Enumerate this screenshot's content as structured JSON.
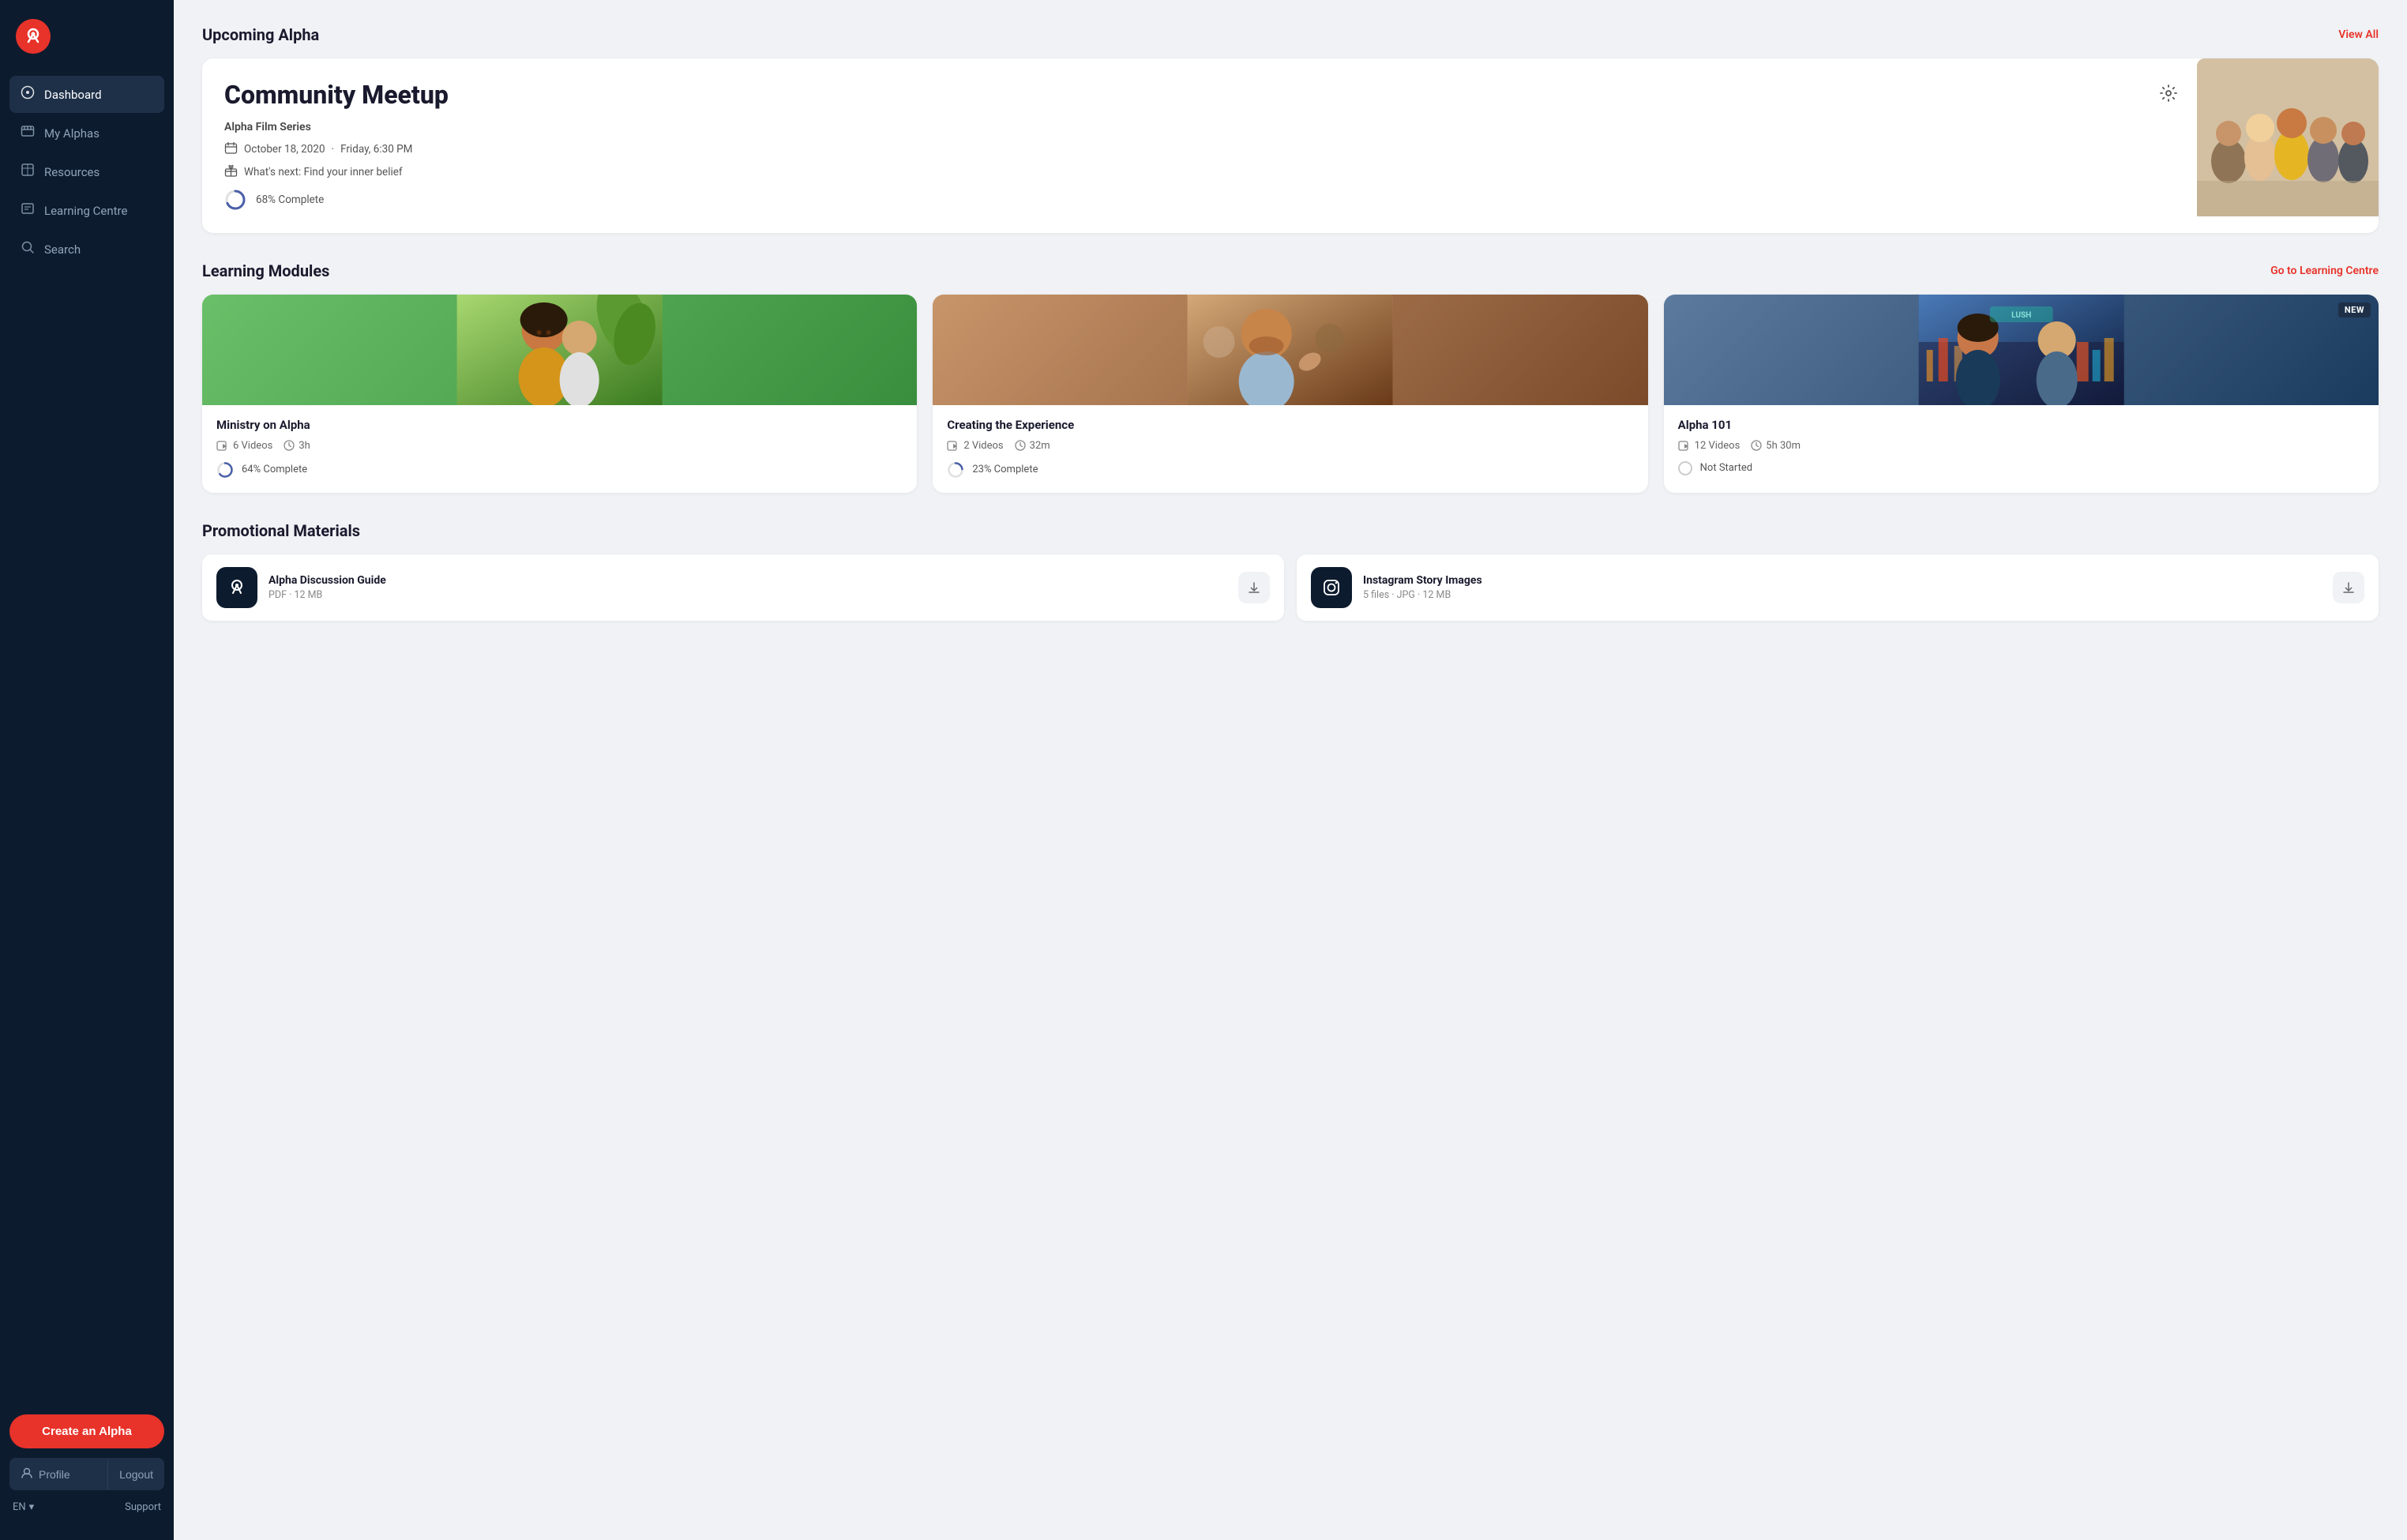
{
  "sidebar": {
    "logo_text": "?",
    "nav_items": [
      {
        "id": "dashboard",
        "label": "Dashboard",
        "icon": "⊙",
        "active": true
      },
      {
        "id": "my-alphas",
        "label": "My Alphas",
        "icon": "⊞"
      },
      {
        "id": "resources",
        "label": "Resources",
        "icon": "▣"
      },
      {
        "id": "learning-centre",
        "label": "Learning Centre",
        "icon": "⊡"
      },
      {
        "id": "search",
        "label": "Search",
        "icon": "⌕"
      }
    ],
    "create_btn_label": "Create an Alpha",
    "profile_label": "Profile",
    "logout_label": "Logout",
    "lang_label": "EN",
    "support_label": "Support"
  },
  "upcoming": {
    "section_title": "Upcoming Alpha",
    "view_all_label": "View All",
    "event_title": "Community Meetup",
    "event_subtitle": "Alpha Film Series",
    "event_date": "October 18, 2020",
    "event_day_time": "Friday, 6:30 PM",
    "event_next": "What's next: Find your inner belief",
    "event_progress_pct": 68,
    "event_progress_label": "68% Complete"
  },
  "learning_modules": {
    "section_title": "Learning Modules",
    "go_to_label": "Go to Learning Centre",
    "modules": [
      {
        "name": "Ministry on Alpha",
        "videos": "6 Videos",
        "duration": "3h",
        "progress_pct": 64,
        "progress_label": "64% Complete",
        "color": "green",
        "is_new": false
      },
      {
        "name": "Creating the Experience",
        "videos": "2 Videos",
        "duration": "32m",
        "progress_pct": 23,
        "progress_label": "23% Complete",
        "color": "brown",
        "is_new": false
      },
      {
        "name": "Alpha 101",
        "videos": "12 Videos",
        "duration": "5h 30m",
        "progress_pct": 0,
        "progress_label": "Not Started",
        "color": "blue",
        "is_new": true
      }
    ]
  },
  "promo_materials": {
    "section_title": "Promotional Materials",
    "items": [
      {
        "title": "Alpha Discussion Guide",
        "meta": "PDF · 12 MB",
        "icon": "?"
      },
      {
        "title": "Instagram Story Images",
        "meta": "5 files · JPG · 12 MB",
        "icon": "◎"
      }
    ]
  }
}
